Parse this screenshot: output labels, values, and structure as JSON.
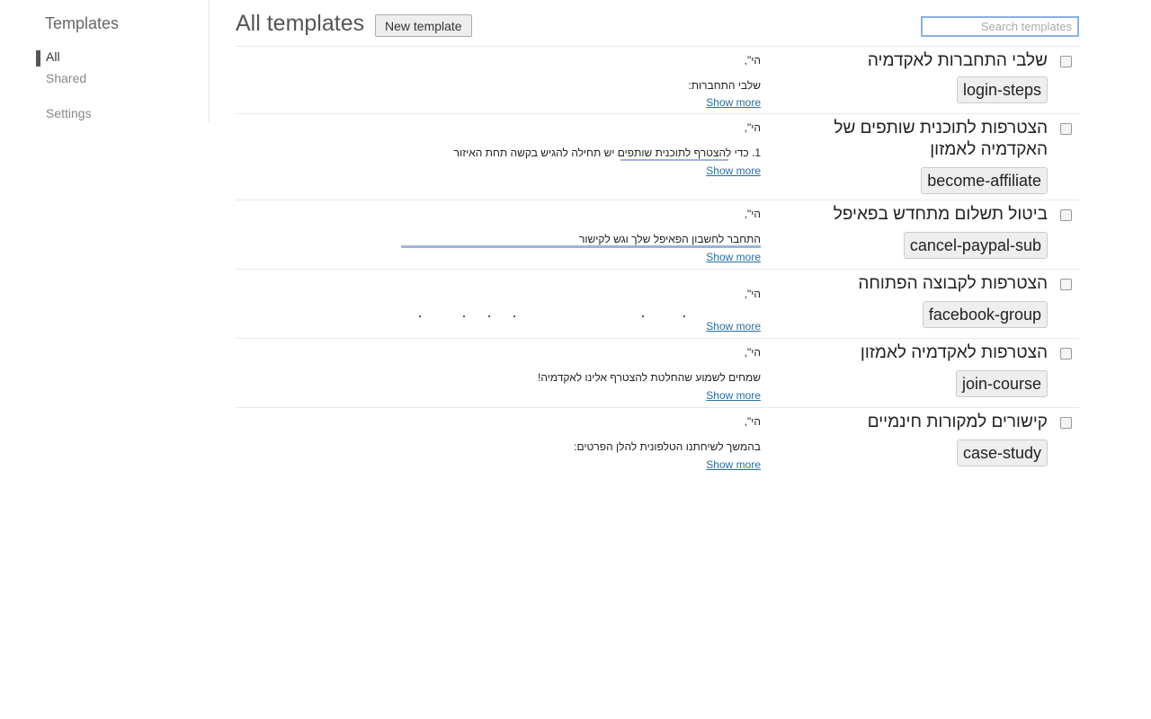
{
  "sidebar": {
    "title": "Templates",
    "items": [
      {
        "label": "All",
        "active": true
      },
      {
        "label": "Shared",
        "active": false
      },
      {
        "label": "Settings",
        "active": false
      }
    ]
  },
  "header": {
    "title": "All templates",
    "new_button": "New template",
    "search_placeholder": "Search templates"
  },
  "show_more": "Show more",
  "templates": [
    {
      "title": "שלבי התחברות לאקדמיה",
      "shortcut": "login-steps",
      "greeting": "הי\",",
      "line": "שלבי התחברות:"
    },
    {
      "title": "הצטרפות לתוכנית שותפים של האקדמיה לאמזון",
      "shortcut": "become-affiliate",
      "greeting": "הי\",",
      "line": "1. כדי להצטרף לתוכנית שותפים יש תחילה להגיש בקשה תחת האיזור"
    },
    {
      "title": "ביטול תשלום מתחדש בפאיפל",
      "shortcut": "cancel-paypal-sub",
      "greeting": "הי\",",
      "line": "התחבר לחשבון הפאיפל שלך וגש לקישור"
    },
    {
      "title": "הצטרפות לקבוצה הפתוחה",
      "shortcut": "facebook-group",
      "greeting": "הי\",",
      "line": ""
    },
    {
      "title": "הצטרפות לאקדמיה לאמזון",
      "shortcut": "join-course",
      "greeting": "הי\",",
      "line": "שמחים לשמוע שהחלטת להצטרף אלינו לאקדמיה!"
    },
    {
      "title": "קישורים למקורות חינמיים",
      "shortcut": "case-study",
      "greeting": "הי\",",
      "line": "בהמשך לשיחתנו הטלפונית להלן הפרטים:"
    }
  ]
}
